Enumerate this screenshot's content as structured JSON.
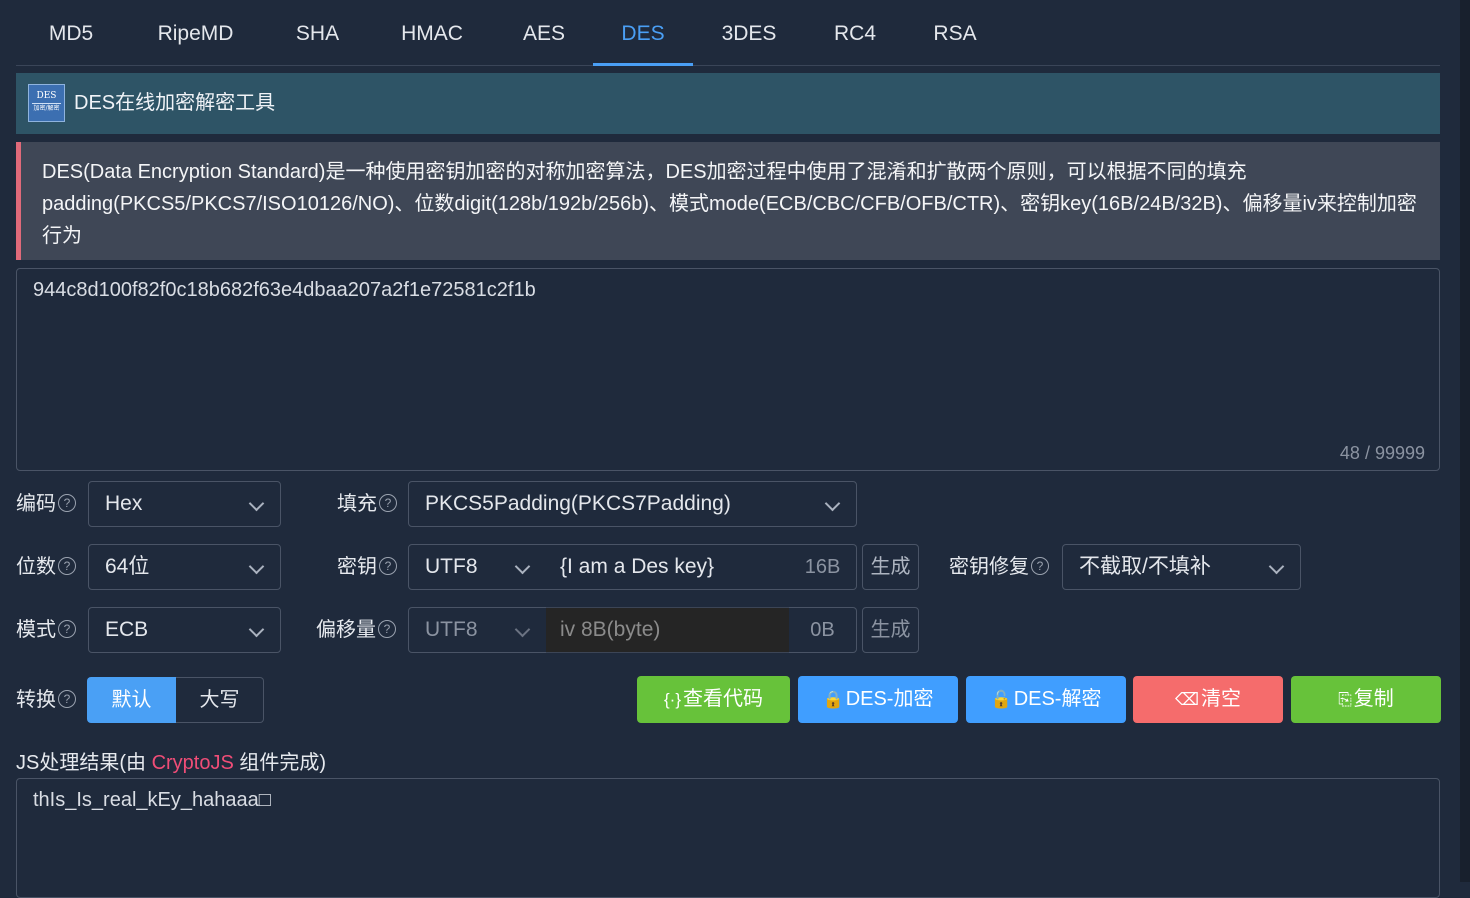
{
  "tabs": [
    "MD5",
    "RipeMD",
    "SHA",
    "HMAC",
    "AES",
    "DES",
    "3DES",
    "RC4",
    "RSA"
  ],
  "active_tab": "DES",
  "banner": {
    "logo_line1": "DES",
    "logo_line2": "加密/解密",
    "title": "DES在线加密解密工具"
  },
  "description": "DES(Data Encryption Standard)是一种使用密钥加密的对称加密算法，DES加密过程中使用了混淆和扩散两个原则，可以根据不同的填充padding(PKCS5/PKCS7/ISO10126/NO)、位数digit(128b/192b/256b)、模式mode(ECB/CBC/CFB/OFB/CTR)、密钥key(16B/24B/32B)、偏移量iv来控制加密行为",
  "input": {
    "value": "944c8d100f82f0c18b682f63e4dbaa207a2f1e72581c2f1b",
    "counter": "48 / 99999"
  },
  "form": {
    "encoding_label": "编码",
    "encoding_value": "Hex",
    "padding_label": "填充",
    "padding_value": "PKCS5Padding(PKCS7Padding)",
    "bits_label": "位数",
    "bits_value": "64位",
    "key_label": "密钥",
    "key_charset": "UTF8",
    "key_value": "{I am a Des key}",
    "key_size": "16B",
    "key_generate": "生成",
    "key_fix_label": "密钥修复",
    "key_fix_value": "不截取/不填补",
    "mode_label": "模式",
    "mode_value": "ECB",
    "iv_label": "偏移量",
    "iv_charset": "UTF8",
    "iv_placeholder": "iv 8B(byte)",
    "iv_size": "0B",
    "iv_generate": "生成",
    "convert_label": "转换",
    "convert_default": "默认",
    "convert_upper": "大写",
    "help_glyph": "?"
  },
  "buttons": {
    "view_code": "查看代码",
    "encrypt": "DES-加密",
    "decrypt": "DES-解密",
    "clear": "清空",
    "copy": "复制"
  },
  "result": {
    "label_prefix": "JS处理结果(由 ",
    "label_lib": "CryptoJS",
    "label_suffix": " 组件完成)",
    "value": "thIs_Is_real_kEy_hahaaa□"
  },
  "colors": {
    "background": "#1f2a3c",
    "accent": "#4a9ff5",
    "banner": "#2e5466",
    "desc_bar": "#e06a7a",
    "green": "#67c23a",
    "blue": "#409eff",
    "red": "#f56c6c",
    "lib_highlight": "#f04d77"
  },
  "icons": {
    "view_code": "code-braces-icon",
    "encrypt": "lock-icon",
    "decrypt": "unlock-icon",
    "clear": "eraser-icon",
    "copy": "copy-document-icon",
    "dropdown": "chevron-down-icon",
    "help": "question-circle-icon"
  }
}
